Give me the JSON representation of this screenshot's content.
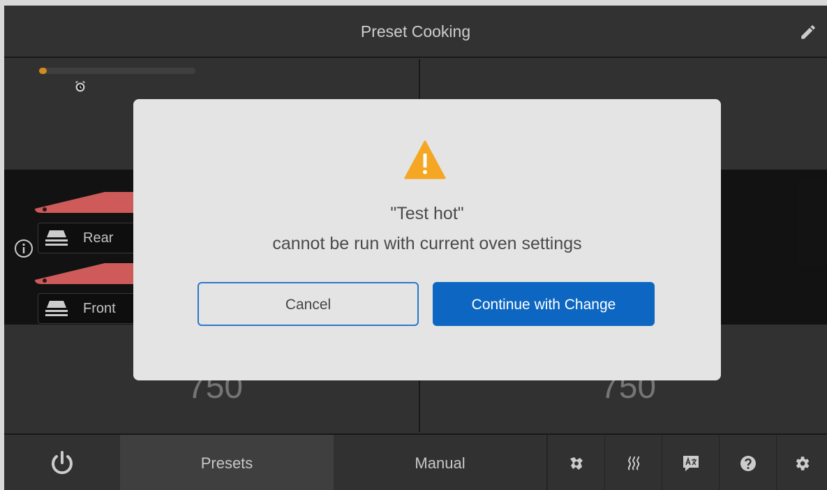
{
  "header": {
    "title": "Preset Cooking",
    "edit_icon": "pencil-icon"
  },
  "timer": {
    "progress": 0.03,
    "progress_color": "#f5a623",
    "icon": "timer-icon"
  },
  "racks": [
    {
      "label": "Rear",
      "icon": "rack-icon"
    },
    {
      "label": "Front",
      "icon": "rack-icon"
    }
  ],
  "info_icon": "info-icon",
  "panels": {
    "left_value": "750",
    "right_value": "750"
  },
  "nav": {
    "power_icon": "power-icon",
    "presets_label": "Presets",
    "manual_label": "Manual",
    "icons": [
      "cleaning-icon",
      "steam-icon",
      "translate-icon",
      "help-icon",
      "settings-icon"
    ]
  },
  "dialog": {
    "icon": "warning-icon",
    "preset_name": "\"Test hot\"",
    "message": "cannot be run with current oven settings",
    "cancel_label": "Cancel",
    "continue_label": "Continue with Change",
    "accent_color": "#0d67c2",
    "warning_color": "#f5a623"
  }
}
